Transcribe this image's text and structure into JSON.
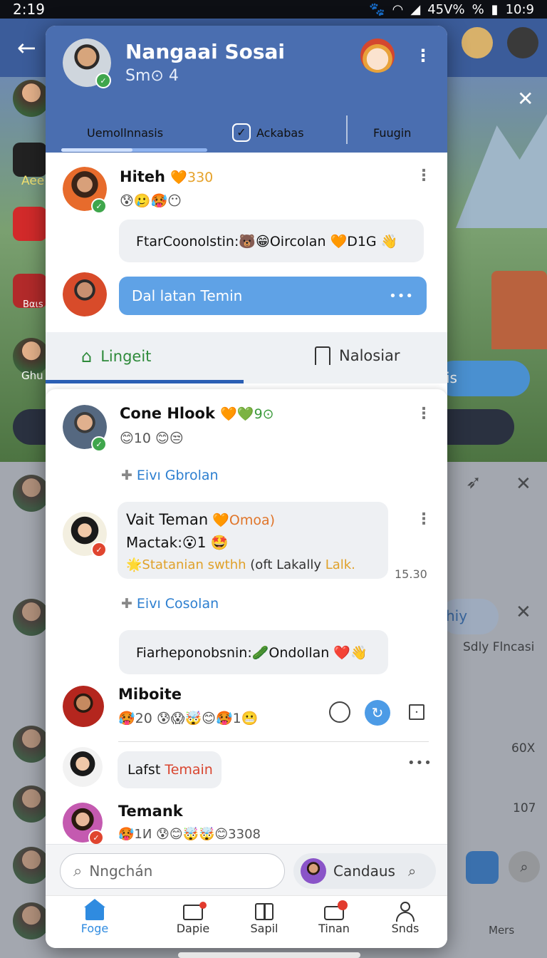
{
  "status_bar": {
    "time_left": "2:19",
    "battery": "45V%",
    "pct": "%",
    "time_right": "10:9",
    "signal": "°"
  },
  "background": {
    "side_labels": [
      "Aee",
      "Bαιs",
      "Ghu",
      "is",
      "60X",
      "107",
      "Sdly Flncasi",
      "Mers"
    ],
    "side_chip": "hiy"
  },
  "header": {
    "title": "Nangaai Sosai",
    "subtitle": "Sm⊙ 4",
    "tabs": [
      "Uemollnnasis",
      "Ackabas",
      "Fuugin"
    ]
  },
  "chat1": {
    "name": "Hiteh",
    "score": "🧡330",
    "reactions": "😰🥲🥵😶",
    "message": "FtarCoonolstin:🐻😁Oircolan 🧡D1G 👋"
  },
  "chat2": {
    "bar_text": "Dal latan Temin",
    "bar_more": "•••"
  },
  "segment": {
    "left": "Lingeit",
    "right": "Nalosiar"
  },
  "chat3": {
    "name": "Cone Hlook",
    "score": "🧡💚9⊙",
    "reactions": "😊10 😊😒",
    "link": "Eivı Gbrolan"
  },
  "chat4": {
    "title_name": "Vait Teman",
    "title_tag": "🧡Omoa)",
    "line2": "Mactak:😮1 🤩",
    "line3_accent": "🌟Statanian swthh",
    "line3_rest": " (oft Lakally ",
    "line3_end": "Lalk.",
    "time": "15.30",
    "link": "Eivı Cosolan",
    "message": "Fiarheponobsnin:🥒Ondollan ❤️👋"
  },
  "chat5": {
    "name": "Miboite",
    "reactions": "🥵20 😰😱🤯😊🥵1😬"
  },
  "chat6": {
    "prefix": "Lafst ",
    "accent": "Temain",
    "more": "•••"
  },
  "chat7": {
    "name": "Temank",
    "reactions": "🥵1И 😰😊🤯🤯😊3308"
  },
  "bottom": {
    "search_placeholder": "Nngchán",
    "chip_label": "Candaus"
  },
  "nav": [
    "Foge",
    "Dapie",
    "Sapil",
    "Tinan",
    "Snds"
  ],
  "colors": {
    "header": "#4a6eb0",
    "accent_blue": "#5fa2e6",
    "active_nav": "#2f8be0",
    "online": "#3fa64c",
    "alert": "#e0452f"
  }
}
